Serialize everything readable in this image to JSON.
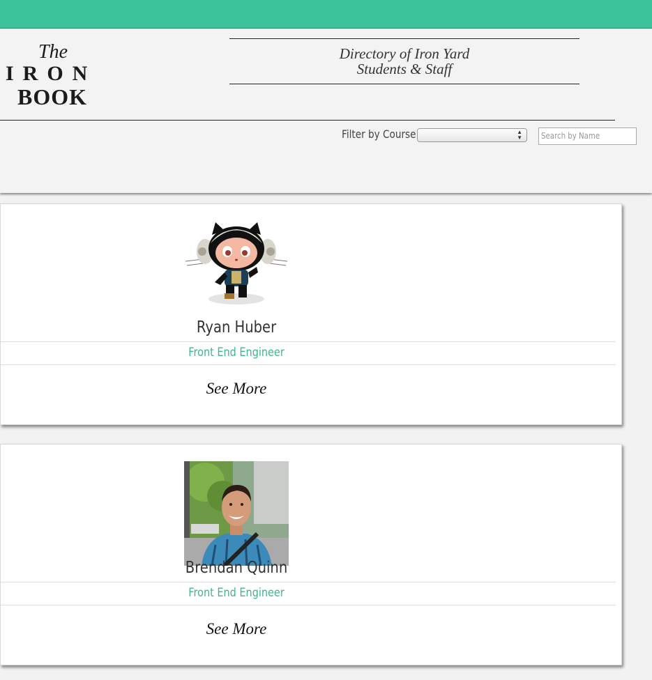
{
  "colors": {
    "accent": "#3cc39c",
    "role_text": "#3fb58e",
    "background": "#f2f2f2"
  },
  "header": {
    "logo": {
      "line1": "The",
      "line2": "IRON",
      "line3": "BOOK"
    },
    "tagline": {
      "line1": "Directory of Iron Yard",
      "line2": "Students & Staff"
    },
    "filter": {
      "label": "Filter by Course",
      "selected": ""
    },
    "search": {
      "placeholder": "Search by Name"
    }
  },
  "people": [
    {
      "name": "Ryan Huber",
      "role": "Front End Engineer",
      "see_more": "See More",
      "avatar": "octocat-avatar"
    },
    {
      "name": "Brendan Quinn",
      "role": "Front End Engineer",
      "see_more": "See More",
      "avatar": "photo-avatar"
    }
  ]
}
